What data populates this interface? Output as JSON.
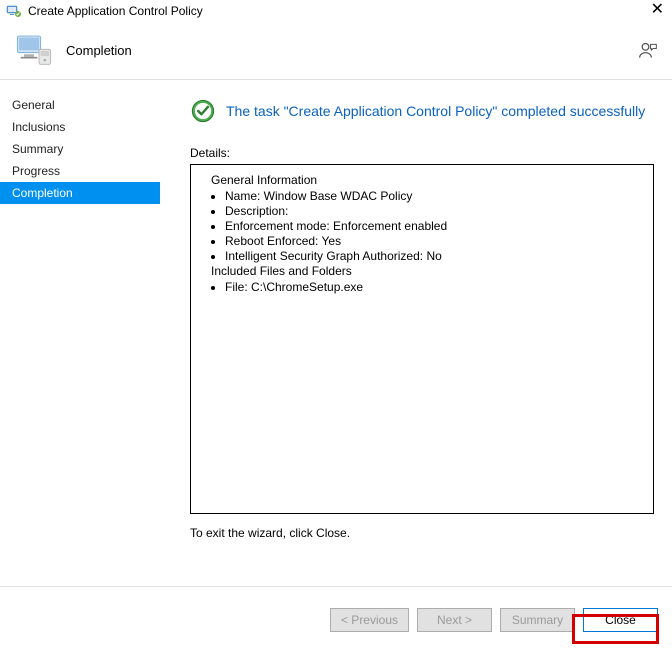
{
  "titlebar": {
    "title": "Create Application Control Policy"
  },
  "header": {
    "title": "Completion"
  },
  "sidebar": {
    "items": [
      {
        "label": "General",
        "selected": false
      },
      {
        "label": "Inclusions",
        "selected": false
      },
      {
        "label": "Summary",
        "selected": false
      },
      {
        "label": "Progress",
        "selected": false
      },
      {
        "label": "Completion",
        "selected": true
      }
    ]
  },
  "main": {
    "successMessage": "The task \"Create Application Control Policy\" completed successfully",
    "detailsLabel": "Details:",
    "details": {
      "generalHeading": "General Information",
      "generalItems": [
        "Name: Window Base WDAC Policy",
        "Description:",
        "Enforcement mode: Enforcement enabled",
        "Reboot Enforced: Yes",
        "Intelligent Security Graph Authorized: No"
      ],
      "includedHeading": "Included Files and Folders",
      "includedItems": [
        "File: C:\\ChromeSetup.exe"
      ]
    },
    "exitText": "To exit the wizard, click Close."
  },
  "footer": {
    "previous": "< Previous",
    "next": "Next >",
    "summary": "Summary",
    "close": "Close"
  }
}
